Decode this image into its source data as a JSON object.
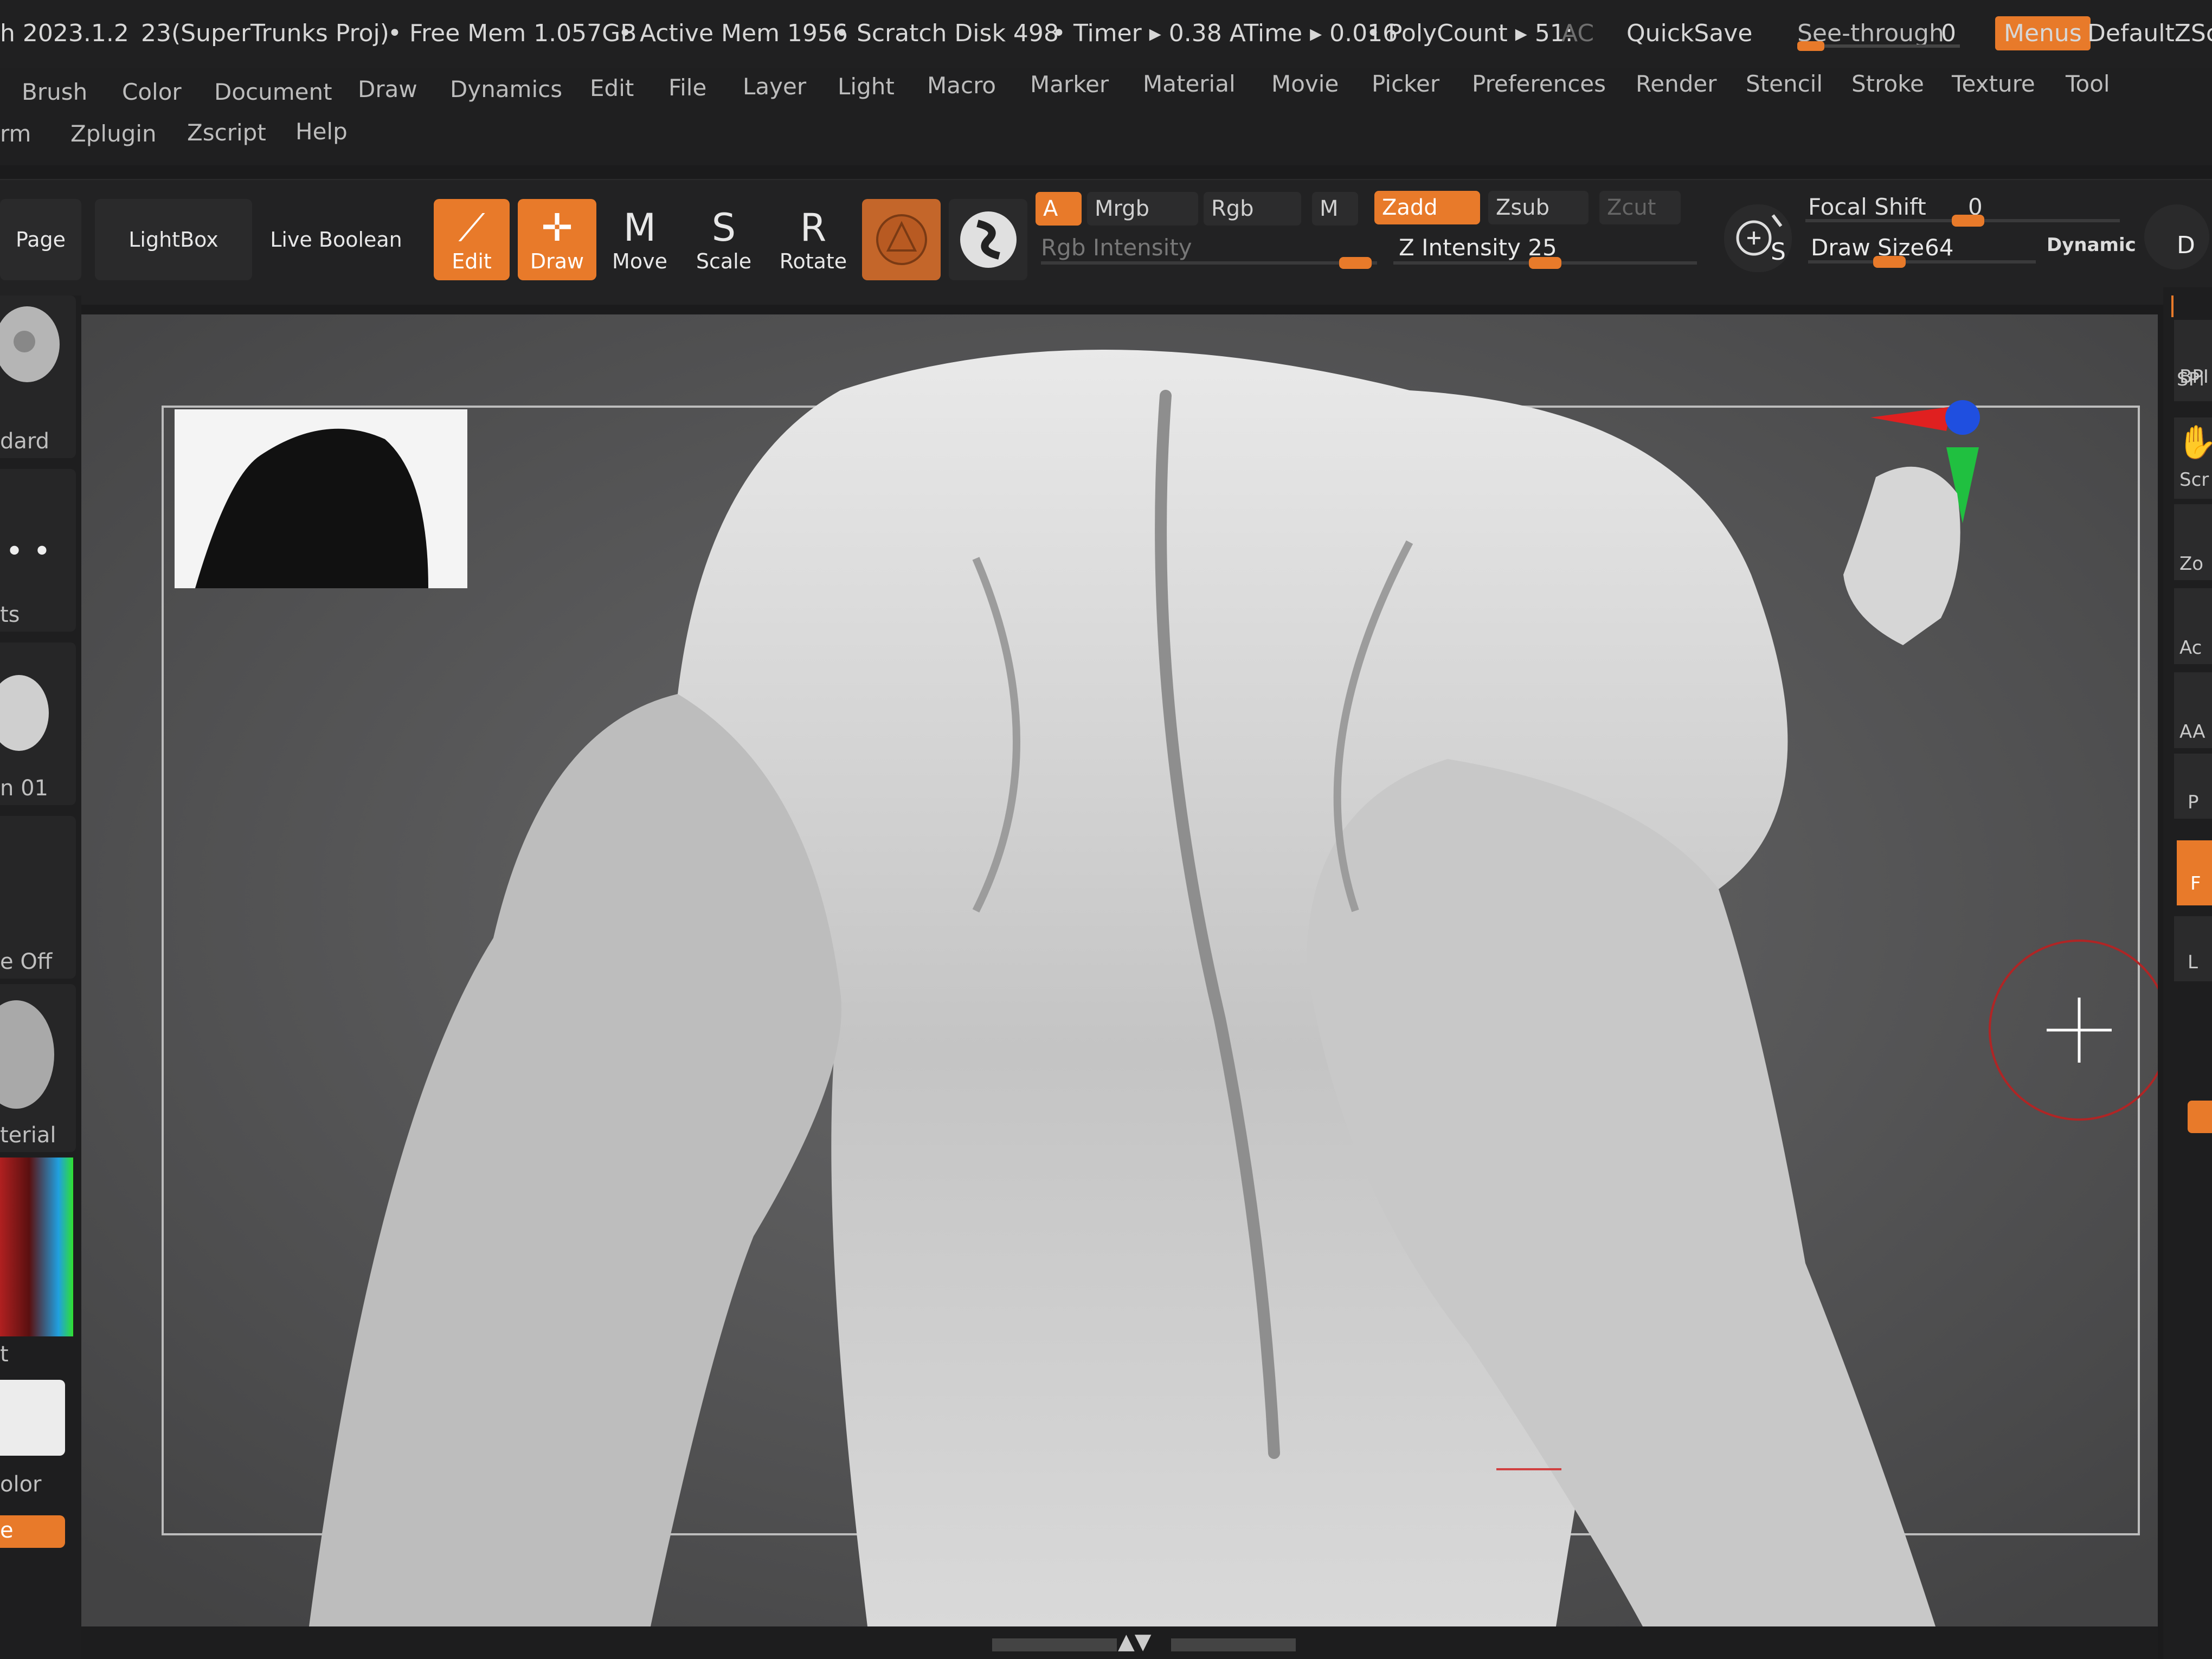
{
  "title_bar": {
    "version": "h 2023.1.2",
    "project": "23(SuperTrunks Proj)",
    "free_mem": "• Free Mem 1.057GB",
    "active_mem": "• Active Mem 1956",
    "scratch": "• Scratch Disk 498",
    "timer": "• Timer ▸ 0.38 ATime ▸ 0.016",
    "polycount": "• PolyCount ▸ 51:",
    "ac": "AC",
    "quicksave": "QuickSave",
    "see_through": "See-through",
    "see_through_value": "0",
    "menus": "Menus",
    "default_script": "DefaultZScri"
  },
  "menu_row1": [
    "Brush",
    "Color",
    "Document",
    "Draw",
    "Dynamics",
    "Edit",
    "File",
    "Layer",
    "Light",
    "Macro",
    "Marker",
    "Material",
    "Movie",
    "Picker",
    "Preferences",
    "Render",
    "Stencil",
    "Stroke",
    "Texture",
    "Tool"
  ],
  "menu_row2": [
    "rm",
    "Zplugin",
    "Zscript",
    "Help"
  ],
  "toolbar": {
    "page": "Page",
    "lightbox": "LightBox",
    "live_boolean": "Live Boolean",
    "edit": "Edit",
    "draw": "Draw",
    "move": "Move",
    "scale": "Scale",
    "rotate": "Rotate",
    "move_key": "M",
    "scale_key": "S",
    "rotate_key": "R",
    "a": "A",
    "mrgb": "Mrgb",
    "rgb": "Rgb",
    "m": "M",
    "zadd": "Zadd",
    "zsub": "Zsub",
    "zcut": "Zcut",
    "rgb_intensity": "Rgb Intensity",
    "z_intensity": "Z Intensity 25",
    "focal_shift": "Focal Shift",
    "focal_shift_value": "0",
    "draw_size": "Draw Size",
    "draw_size_value": "64",
    "dynamic": "Dynamic",
    "s_label": "S",
    "d_label": "D"
  },
  "left_shelf": [
    "dard",
    "ts",
    "n 01",
    "e Off",
    "terial",
    "t",
    "olor",
    "e"
  ],
  "right_shelf": [
    "BPI",
    "SPi",
    "Scr",
    "Zo",
    "Ac",
    "AA",
    "P",
    "F",
    "L"
  ],
  "colors": {
    "accent": "#e87a2a",
    "background": "#1b1b1c",
    "canvas": "#5c5c5d"
  },
  "icons": [
    "edit-icon",
    "draw-icon",
    "move-icon",
    "scale-icon",
    "rotate-icon",
    "material-sphere-icon",
    "gyro-icon",
    "navigation-head-icon",
    "cursor-crosshair-icon"
  ]
}
